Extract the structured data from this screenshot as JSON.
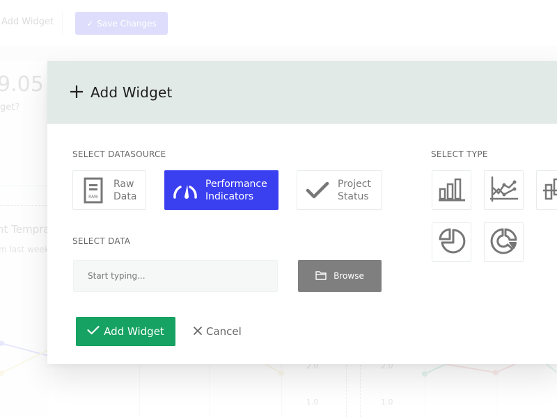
{
  "background": {
    "toolbar": {
      "add_widget_label": "Add Widget",
      "save_changes_label": "Save Changes"
    },
    "card": {
      "big_number": "9.05",
      "question": "get?",
      "temperature_title": "nt Temprat",
      "subtitle": "m last week"
    },
    "axis_labels": [
      "2.0",
      "2.0",
      "1.0",
      "1.0"
    ],
    "colors": {
      "series_blue": "#9a9cf5",
      "series_yellow": "#f0e3a0",
      "series_teal": "#7fd1b8",
      "series_red": "#f0a0a0"
    }
  },
  "modal": {
    "title": "Add Widget",
    "header_icon": "plus-icon",
    "datasource": {
      "label": "SELECT DATASOURCE",
      "options": [
        {
          "line1": "Raw",
          "line2": "Data",
          "icon": "raw-data-icon",
          "icon_text": "RAW",
          "selected": false
        },
        {
          "line1": "Performance",
          "line2": "Indicators",
          "icon": "gauge-icon",
          "selected": true
        },
        {
          "line1": "Project",
          "line2": "Status",
          "icon": "checkmark-icon",
          "selected": false
        }
      ]
    },
    "type": {
      "label": "SELECT TYPE",
      "options": [
        {
          "icon": "bar-chart-icon"
        },
        {
          "icon": "line-chart-icon"
        },
        {
          "icon": "candlestick-chart-icon"
        },
        {
          "icon": "pie-chart-icon"
        },
        {
          "icon": "donut-chart-icon"
        }
      ]
    },
    "data": {
      "label": "SELECT DATA",
      "input_placeholder": "Start typing...",
      "input_value": "",
      "browse_label": "Browse",
      "browse_icon": "folder-icon"
    },
    "actions": {
      "add_label": "Add Widget",
      "cancel_label": "Cancel"
    },
    "colors": {
      "header_bg": "#e2eae7",
      "accent_blue": "#3a3ff0",
      "add_green": "#16a262",
      "browse_gray": "#7f7f7f"
    }
  }
}
